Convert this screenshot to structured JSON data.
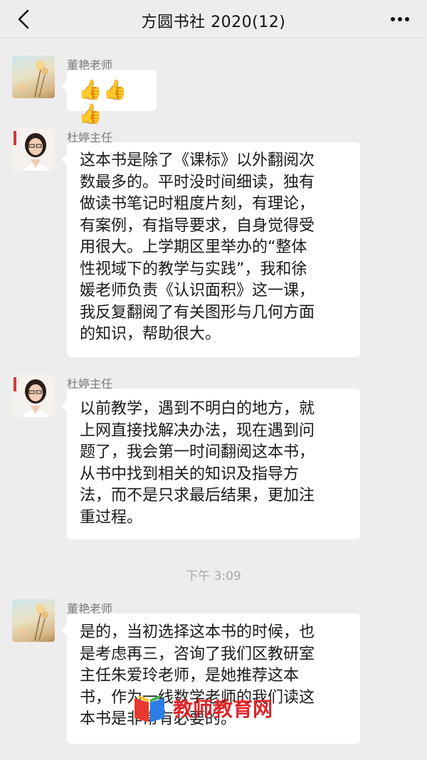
{
  "header": {
    "title": "方圆书社 2020(12)",
    "back_icon": "chevron-left-icon",
    "more_icon": "more-dots-icon"
  },
  "messages": [
    {
      "sender": "董艳老师",
      "avatar": "flower-avatar",
      "content": "👍👍👍"
    },
    {
      "sender": "杜婷主任",
      "avatar": "person-avatar",
      "content": "这本书是除了《课标》以外翻阅次\n数最多的。平时没时间细读，独有\n做读书笔记时粗度片刻，有理论，\n有案例，有指导要求，自身觉得受\n用很大。上学期区里举办的“整体\n性视域下的教学与实践”，我和徐\n媛老师负责《认识面积》这一课，\n我反复翻阅了有关图形与几何方面\n的知识，帮助很大。"
    },
    {
      "sender": "杜婷主任",
      "avatar": "person-avatar",
      "content": "以前教学，遇到不明白的地方，就\n上网直接找解决办法，现在遇到问\n题了，我会第一时间翻阅这本书，\n从书中找到相关的知识及指导方\n法，而不是只求最后结果，更加注\n重过程。"
    },
    {
      "sender": "董艳老师",
      "avatar": "flower-avatar",
      "content": "是的，当初选择这本书的时候，也\n是考虑再三，咨询了我们区教研室\n主任朱爱玲老师，是她推荐这本\n书，作为一线数学老师的我们读这\n本书是非常有必要的。"
    }
  ],
  "timestamp": "下午 3:09",
  "watermark": {
    "text": "教师教育网"
  },
  "colors": {
    "background": "#ededed",
    "bubble": "#ffffff",
    "meta_text": "#7a7a7a",
    "watermark": "#e0262a"
  }
}
